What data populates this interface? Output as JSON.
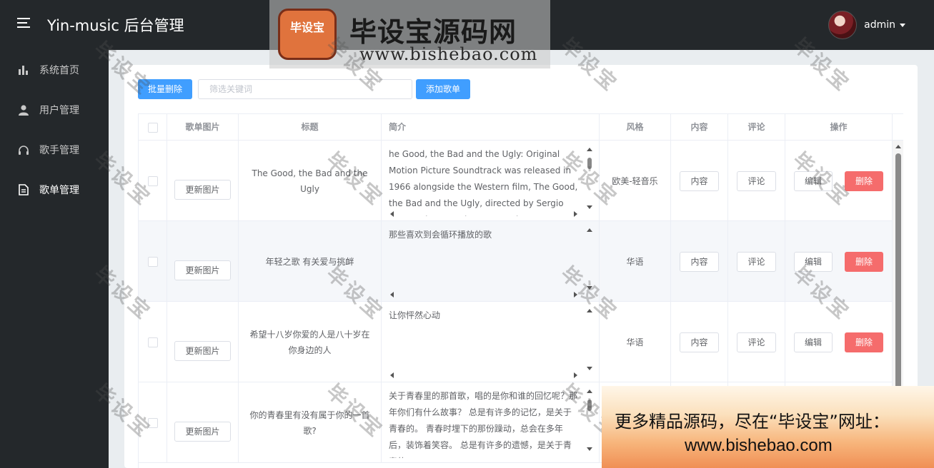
{
  "header": {
    "title": "Yin-music 后台管理",
    "user_name": "admin"
  },
  "sidebar": {
    "items": [
      {
        "label": "系统首页",
        "icon": "bar-chart-icon",
        "active": false
      },
      {
        "label": "用户管理",
        "icon": "user-icon",
        "active": false
      },
      {
        "label": "歌手管理",
        "icon": "headphones-icon",
        "active": false
      },
      {
        "label": "歌单管理",
        "icon": "document-icon",
        "active": true
      }
    ]
  },
  "toolbar": {
    "batch_delete_label": "批量删除",
    "filter_placeholder": "筛选关键词",
    "add_label": "添加歌单"
  },
  "table": {
    "columns": [
      "歌单图片",
      "标题",
      "简介",
      "风格",
      "内容",
      "评论",
      "操作"
    ],
    "update_image_label": "更新图片",
    "content_label": "内容",
    "comment_label": "评论",
    "edit_label": "编辑",
    "delete_label": "删除",
    "rows": [
      {
        "title": "The Good, the Bad and the Ugly",
        "intro": "he Good, the Bad and the Ugly: Original Motion Picture Soundtrack was released in 1966 alongside the Western film, The Good, the Bad and the Ugly, directed by Sergio Leone. The score is composed",
        "style": "欧美-轻音乐"
      },
      {
        "title": "年轻之歌 有关爱与挑衅",
        "intro": "那些喜欢到会循环播放的歌",
        "style": "华语"
      },
      {
        "title": "希望十八岁你爱的人是八十岁在你身边的人",
        "intro": "让你怦然心动",
        "style": "华语"
      },
      {
        "title": "你的青春里有没有属于你的一首歌?",
        "intro": "关于青春里的那首歌，唱的是你和谁的回忆呢？那年你们有什么故事？ 总是有许多的记忆，是关于青春的。 青春时埋下的那份躁动，总会在多年后，装饰着笑容。 总是有许多的遗憾，是关于青春的。",
        "style": ""
      }
    ]
  },
  "watermark": {
    "badge": "毕设宝",
    "title": "毕设宝源码网",
    "url": "www.bishebao.com",
    "stamp": "毕设宝"
  },
  "promo": {
    "line1": "更多精品源码，尽在“毕设宝”网址：",
    "line2": "www.bishebao.com"
  },
  "colors": {
    "primary": "#409eff",
    "danger": "#f56c6c",
    "sidebar_bg": "#24282b"
  }
}
